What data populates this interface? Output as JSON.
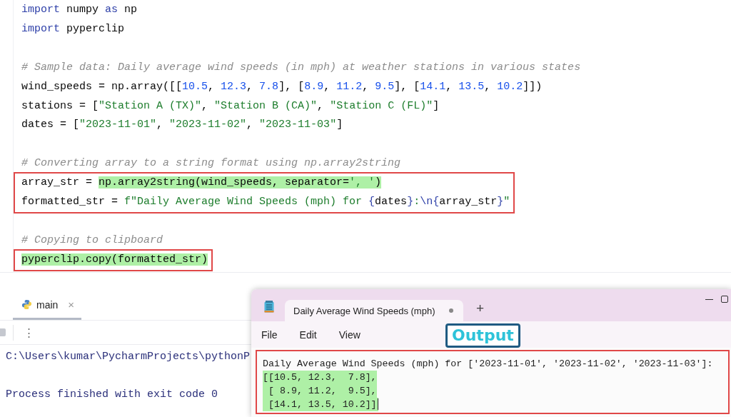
{
  "editor": {
    "blocks": [
      {
        "lines": [
          {
            "boxed": false,
            "segments": [
              {
                "text": "import",
                "kind": "keyword"
              },
              {
                "text": " numpy ",
                "kind": "plain"
              },
              {
                "text": "as",
                "kind": "keyword"
              },
              {
                "text": " np",
                "kind": "plain"
              }
            ]
          },
          {
            "boxed": false,
            "segments": [
              {
                "text": "import",
                "kind": "keyword"
              },
              {
                "text": " pyperclip",
                "kind": "plain"
              }
            ]
          }
        ]
      },
      {
        "lines": [
          {
            "boxed": false,
            "segments": [
              {
                "text": "# Sample data: Daily average wind speeds (in mph) at weather stations in various states",
                "kind": "comment"
              }
            ]
          },
          {
            "boxed": false,
            "segments": [
              {
                "text": "wind_speeds = np.array([[",
                "kind": "plain"
              },
              {
                "text": "10.5",
                "kind": "number"
              },
              {
                "text": ", ",
                "kind": "plain"
              },
              {
                "text": "12.3",
                "kind": "number"
              },
              {
                "text": ", ",
                "kind": "plain"
              },
              {
                "text": "7.8",
                "kind": "number"
              },
              {
                "text": "], [",
                "kind": "plain"
              },
              {
                "text": "8.9",
                "kind": "number"
              },
              {
                "text": ", ",
                "kind": "plain"
              },
              {
                "text": "11.2",
                "kind": "number"
              },
              {
                "text": ", ",
                "kind": "plain"
              },
              {
                "text": "9.5",
                "kind": "number"
              },
              {
                "text": "], [",
                "kind": "plain"
              },
              {
                "text": "14.1",
                "kind": "number"
              },
              {
                "text": ", ",
                "kind": "plain"
              },
              {
                "text": "13.5",
                "kind": "number"
              },
              {
                "text": ", ",
                "kind": "plain"
              },
              {
                "text": "10.2",
                "kind": "number"
              },
              {
                "text": "]])",
                "kind": "plain"
              }
            ]
          },
          {
            "boxed": false,
            "segments": [
              {
                "text": "stations = [",
                "kind": "plain"
              },
              {
                "text": "\"Station A (TX)\"",
                "kind": "string"
              },
              {
                "text": ", ",
                "kind": "plain"
              },
              {
                "text": "\"Station B (CA)\"",
                "kind": "string"
              },
              {
                "text": ", ",
                "kind": "plain"
              },
              {
                "text": "\"Station C (FL)\"",
                "kind": "string"
              },
              {
                "text": "]",
                "kind": "plain"
              }
            ]
          },
          {
            "boxed": false,
            "segments": [
              {
                "text": "dates = [",
                "kind": "plain"
              },
              {
                "text": "\"2023-11-01\"",
                "kind": "string"
              },
              {
                "text": ", ",
                "kind": "plain"
              },
              {
                "text": "\"2023-11-02\"",
                "kind": "string"
              },
              {
                "text": ", ",
                "kind": "plain"
              },
              {
                "text": "\"2023-11-03\"",
                "kind": "string"
              },
              {
                "text": "]",
                "kind": "plain"
              }
            ]
          }
        ]
      },
      {
        "lines": [
          {
            "boxed": false,
            "segments": [
              {
                "text": "# Converting array to a string format using np.array2string",
                "kind": "comment"
              }
            ]
          },
          {
            "boxed": true,
            "segments": [
              {
                "text": "array_str = ",
                "kind": "plain"
              },
              {
                "text": "np.array2string(wind_speeds, separator=",
                "kind": "plain",
                "marked": true
              },
              {
                "text": "', '",
                "kind": "string",
                "marked": true
              },
              {
                "text": ")",
                "kind": "plain",
                "marked": true
              }
            ]
          },
          {
            "boxed": true,
            "segments": [
              {
                "text": "formatted_str = ",
                "kind": "plain"
              },
              {
                "text": "f\"Daily Average Wind Speeds (mph) for ",
                "kind": "string"
              },
              {
                "text": "{",
                "kind": "escape"
              },
              {
                "text": "dates",
                "kind": "plain"
              },
              {
                "text": "}",
                "kind": "escape"
              },
              {
                "text": ":",
                "kind": "string"
              },
              {
                "text": "\\n",
                "kind": "escape"
              },
              {
                "text": "{",
                "kind": "escape"
              },
              {
                "text": "array_str",
                "kind": "plain"
              },
              {
                "text": "}",
                "kind": "escape"
              },
              {
                "text": "\"",
                "kind": "string"
              }
            ]
          }
        ]
      },
      {
        "lines": [
          {
            "boxed": false,
            "segments": [
              {
                "text": "# Copying to clipboard",
                "kind": "comment"
              }
            ]
          },
          {
            "boxed": true,
            "segments": [
              {
                "text": "pyperclip.copy(formatted_str)",
                "kind": "plain",
                "marked": true
              }
            ]
          }
        ]
      }
    ]
  },
  "run_panel": {
    "tab": {
      "label": "main",
      "close": "×",
      "selected": true
    },
    "menu_glyph": "⋮",
    "console": [
      {
        "text": "C:\\Users\\kumar\\PycharmProjects\\pythonP"
      },
      {
        "text": "Process finished with exit code 0"
      }
    ]
  },
  "notepad": {
    "tab_title": "Daily Average Wind Speeds (mph)",
    "unsaved": true,
    "new_tab": "+",
    "menu": [
      "File",
      "Edit",
      "View"
    ],
    "content": [
      {
        "text": "Daily Average Wind Speeds (mph) for ['2023-11-01', '2023-11-02', '2023-11-03']:",
        "marked": false
      },
      {
        "text": "[[10.5, 12.3,  7.8],",
        "marked": true
      },
      {
        "text": " [ 8.9, 11.2,  9.5],",
        "marked": true
      },
      {
        "text": " [14.1, 13.5, 10.2]]",
        "marked": true
      }
    ]
  },
  "annotation": {
    "label": "Output"
  }
}
